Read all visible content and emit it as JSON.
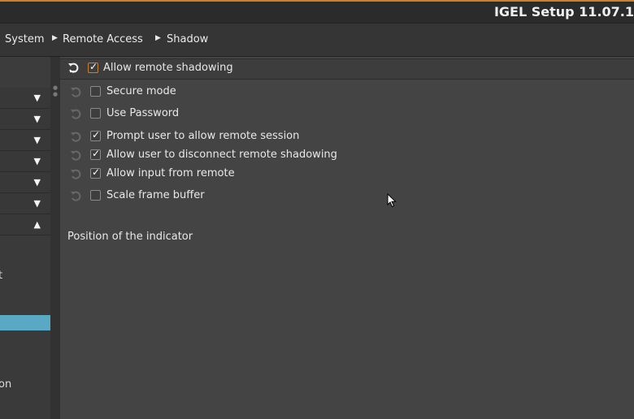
{
  "window": {
    "title": "IGEL Setup 11.07.1"
  },
  "breadcrumb": [
    {
      "label": "System"
    },
    {
      "label": "Remote Access"
    },
    {
      "label": "Shadow"
    }
  ],
  "sidebar": {
    "dropdowns": [
      {
        "icon": "chevron-down-icon"
      },
      {
        "icon": "chevron-down-icon"
      },
      {
        "icon": "chevron-down-icon"
      },
      {
        "icon": "chevron-down-icon"
      },
      {
        "icon": "chevron-down-icon"
      },
      {
        "icon": "chevron-down-icon"
      },
      {
        "icon": "chevron-up-icon"
      }
    ],
    "partial_text_1": "t",
    "partial_text_2": "on",
    "selected_color": "#5aa9c4"
  },
  "settings": {
    "allow_remote_shadowing": {
      "label": "Allow remote shadowing",
      "checked": true
    },
    "options": [
      {
        "label": "Secure mode",
        "checked": false
      },
      {
        "label": "Use Password",
        "checked": false
      },
      {
        "label": "Prompt user to allow remote session",
        "checked": true
      },
      {
        "label": "Allow user to disconnect remote shadowing",
        "checked": true
      },
      {
        "label": "Allow input from remote",
        "checked": true
      },
      {
        "label": "Scale frame buffer",
        "checked": false
      }
    ],
    "indicator_section_label": "Position of the indicator"
  },
  "colors": {
    "accent": "#c8802a",
    "background": "#444444",
    "sidebar_selected": "#5aa9c4"
  }
}
